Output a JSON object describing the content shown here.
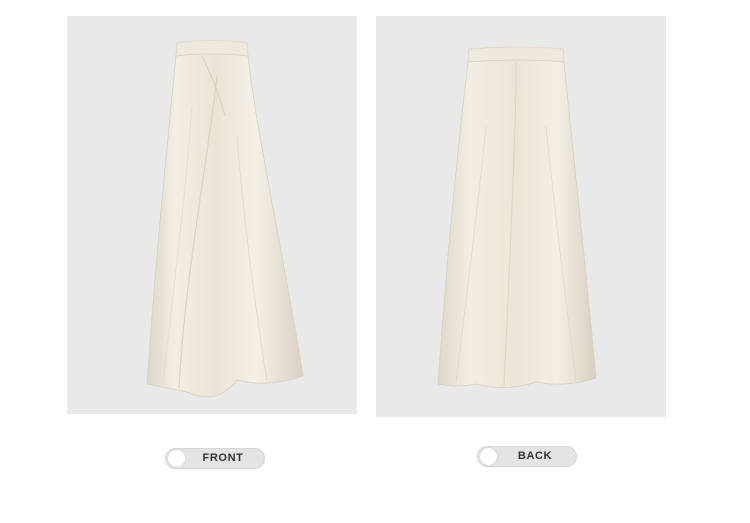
{
  "colors": {
    "photo_background": "#e9e9e9",
    "skirt_fabric": "#efe9dc",
    "pill_background": "#e4e4e4",
    "pill_text": "#333333"
  },
  "views": {
    "front": {
      "label": "FRONT",
      "icon": "radio-dot-icon"
    },
    "back": {
      "label": "BACK",
      "icon": "radio-dot-icon"
    }
  }
}
